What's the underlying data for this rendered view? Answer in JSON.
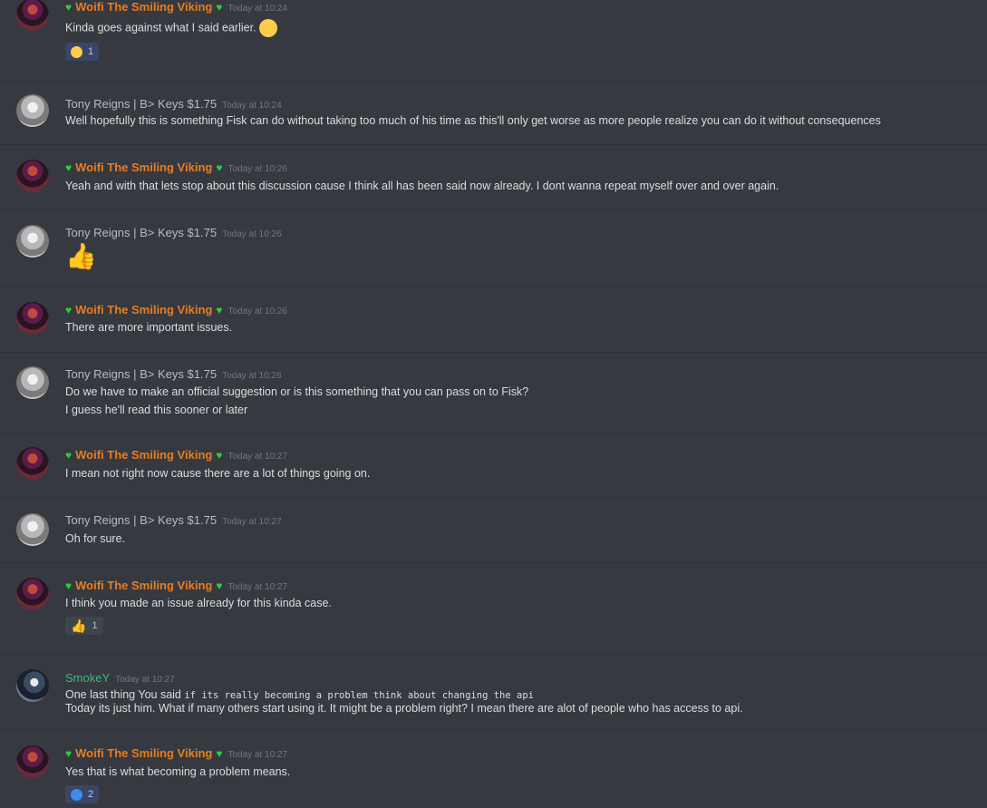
{
  "messages": [
    {
      "author": "Woifi The Smiling Viking",
      "timestamp": "Today at 10:24",
      "lines": [
        "Kinda goes against what I said earlier."
      ],
      "reaction": {
        "emoji": "tongue-face",
        "count": "1"
      }
    },
    {
      "author": "Tony Reigns | B> Keys $1.75",
      "timestamp": "Today at 10:24",
      "lines": [
        "Well hopefully this is something Fisk can do without taking too much of his time as this'll only get worse as more people realize you can do it without consequences"
      ]
    },
    {
      "author": "Woifi The Smiling Viking",
      "timestamp": "Today at 10:26",
      "lines": [
        "Yeah and with that lets stop about this discussion cause I think all has been said now already. I dont wanna repeat myself over and over again."
      ]
    },
    {
      "author": "Tony Reigns | B> Keys $1.75",
      "timestamp": "Today at 10:26",
      "emoji": "thumbs-up"
    },
    {
      "author": "Woifi The Smiling Viking",
      "timestamp": "Today at 10:26",
      "lines": [
        "There are more important issues."
      ]
    },
    {
      "author": "Tony Reigns | B> Keys $1.75",
      "timestamp": "Today at 10:26",
      "lines": [
        "Do we have to make an official suggestion or is this something that you can pass on to Fisk?",
        "I guess he'll read this sooner or later"
      ]
    },
    {
      "author": "Woifi The Smiling Viking",
      "timestamp": "Today at 10:27",
      "lines": [
        "I mean not right now cause there are a lot of things going on."
      ]
    },
    {
      "author": "Tony Reigns | B> Keys $1.75",
      "timestamp": "Today at 10:27",
      "lines": [
        "Oh for sure."
      ]
    },
    {
      "author": "Woifi The Smiling Viking",
      "timestamp": "Today at 10:27",
      "lines": [
        "I think you made an issue already for this kinda case."
      ],
      "reaction": {
        "emoji": "thumbs-up",
        "count": "1"
      }
    },
    {
      "author": "SmokeY",
      "timestamp": "Today at 10:27",
      "line1_prefix": "One last thing You said ",
      "line1_code": "if its really becoming a problem think about changing the api",
      "lines": [
        "Today its just him. What if many others start using it. It might be a problem right?  I mean there are alot of people who has access to api."
      ]
    },
    {
      "author": "Woifi The Smiling Viking",
      "timestamp": "Today at 10:27",
      "lines": [
        "Yes that is what becoming a problem means."
      ],
      "reaction": {
        "emoji": "thinking-face",
        "count": "2"
      }
    }
  ],
  "colors": {
    "background": "#36393f",
    "woifi": "#e67e22",
    "smokey": "#43b581",
    "tony": "#b9bbbe",
    "heart": "#2ecc40"
  }
}
